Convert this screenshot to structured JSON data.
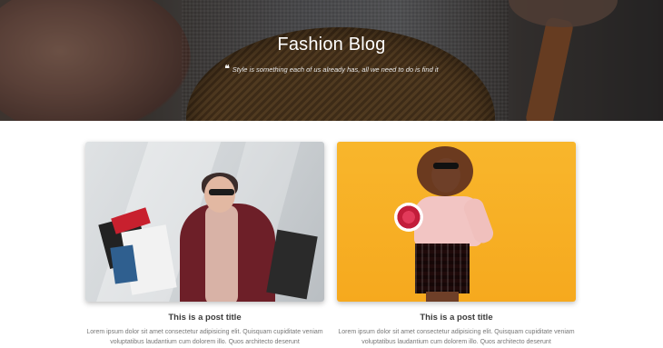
{
  "hero": {
    "title": "Fashion Blog",
    "quote_icon": "❝",
    "quote": "Style is something each of us already has, all we need to do is find it"
  },
  "posts": [
    {
      "title": "This is a post title",
      "excerpt": "Lorem ipsum dolor sit amet consectetur adipisicing elit. Quisquam cupiditate veniam voluptatibus laudantium cum dolorem illo. Quos architecto deserunt"
    },
    {
      "title": "This is a post title",
      "excerpt": "Lorem ipsum dolor sit amet consectetur adipisicing elit. Quisquam cupiditate veniam voluptatibus laudantium cum dolorem illo. Quos architecto deserunt"
    }
  ],
  "colors": {
    "hero_overlay": "#000000",
    "card_bg_1": "#d3d7da",
    "card_bg_2": "#f7b026",
    "title_text": "#3b3b3b",
    "body_text": "#777777"
  }
}
